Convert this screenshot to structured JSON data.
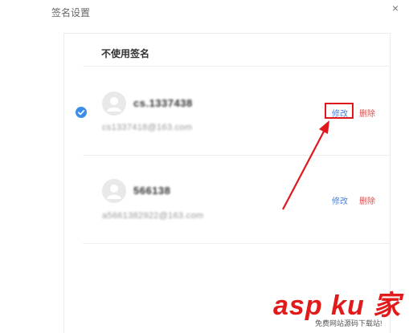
{
  "dialog": {
    "title": "签名设置",
    "close_icon": "×"
  },
  "no_signature_label": "不使用签名",
  "signatures": [
    {
      "name": "cs.1337438",
      "email": "cs1337418@163.com",
      "selected": true,
      "edit_label": "修改",
      "delete_label": "删除"
    },
    {
      "name": "566138",
      "email": "a5661382922@163.com",
      "selected": false,
      "edit_label": "修改",
      "delete_label": "删除"
    }
  ],
  "colors": {
    "accent": "#4a7fd6",
    "danger": "#e04a4a",
    "annotation": "#e0171d",
    "check": "#3d8ee8"
  },
  "watermark": {
    "main": "asp ku 家",
    "sub": "免费网站源码下载站!"
  }
}
